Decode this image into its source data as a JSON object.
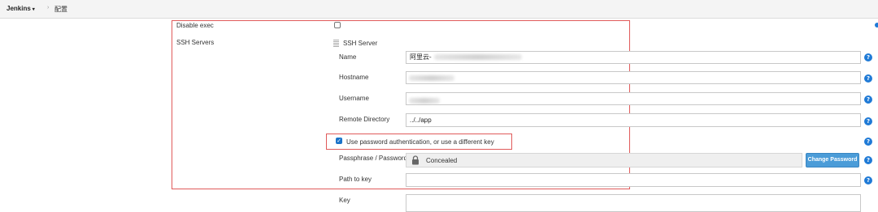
{
  "breadcrumb": {
    "root": "Jenkins",
    "separator": "›",
    "page": "配置"
  },
  "form": {
    "disable_exec_label": "Disable exec",
    "ssh_servers_label": "SSH Servers",
    "ssh_server_heading": "SSH Server",
    "name_label": "Name",
    "name_value": "阿里云-",
    "hostname_label": "Hostname",
    "username_label": "Username",
    "remote_directory_label": "Remote Directory",
    "remote_directory_value": "../../app",
    "use_password_label": "Use password authentication, or use a different key",
    "passphrase_label": "Passphrase / Password",
    "concealed_text": "Concealed",
    "change_password_button": "Change Password",
    "path_to_key_label": "Path to key",
    "key_label": "Key",
    "help_glyph": "?"
  },
  "state": {
    "disable_exec_checked": false,
    "use_password_checked": true
  },
  "colors": {
    "accent": "#1f7ad6",
    "highlight_border": "#e05a5a",
    "button": "#4b9cd8"
  },
  "icons": [
    "chevron-down-icon",
    "breadcrumb-separator-icon",
    "drag-handle-icon",
    "lock-icon",
    "help-icon",
    "checkmark-icon"
  ]
}
